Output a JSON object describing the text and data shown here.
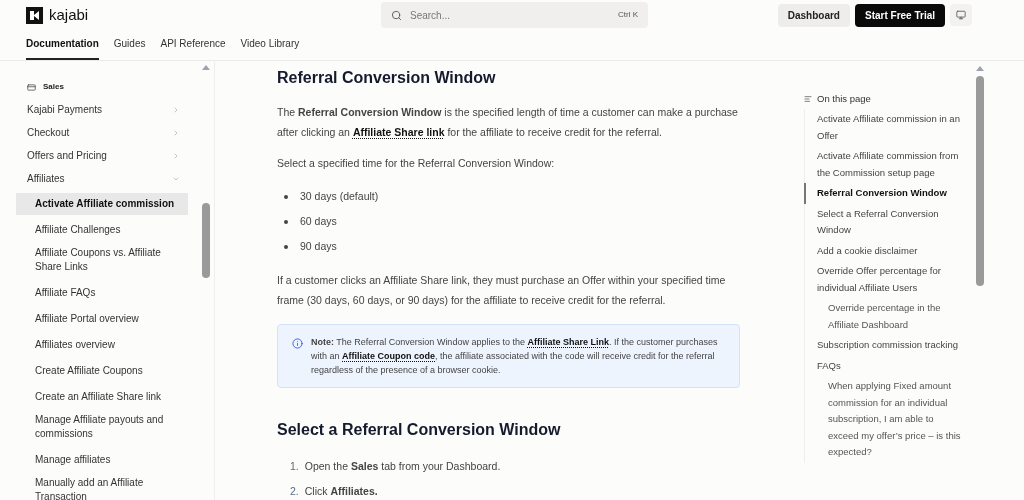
{
  "header": {
    "logo_text": "kajabi",
    "search": {
      "placeholder": "Search...",
      "shortcut": "Ctrl K"
    },
    "buttons": [
      {
        "label": "Dashboard",
        "kind": "secondary"
      },
      {
        "label": "Start Free Trial",
        "kind": "primary"
      }
    ]
  },
  "tabs": [
    {
      "label": "Documentation",
      "selected": true
    },
    {
      "label": "Guides",
      "selected": false
    },
    {
      "label": "API Reference",
      "selected": false
    },
    {
      "label": "Video Library",
      "selected": false
    }
  ],
  "sidebar": {
    "section": "Sales",
    "items": [
      {
        "label": "Kajabi Payments",
        "expanded": false
      },
      {
        "label": "Checkout",
        "expanded": false
      },
      {
        "label": "Offers and Pricing",
        "expanded": false
      },
      {
        "label": "Affiliates",
        "expanded": true,
        "children": [
          {
            "label": "Activate Affiliate commission",
            "selected": true
          },
          {
            "label": "Affiliate Challenges",
            "selected": false
          },
          {
            "label": "Affiliate Coupons vs. Affiliate Share Links",
            "selected": false
          },
          {
            "label": "Affiliate FAQs",
            "selected": false
          },
          {
            "label": "Affiliate Portal overview",
            "selected": false
          },
          {
            "label": "Affiliates overview",
            "selected": false
          },
          {
            "label": "Create Affiliate Coupons",
            "selected": false
          },
          {
            "label": "Create an Affiliate Share link",
            "selected": false
          },
          {
            "label": "Manage Affiliate payouts and commissions",
            "selected": false
          },
          {
            "label": "Manage affiliates",
            "selected": false
          },
          {
            "label": "Manually add an Affiliate Transaction",
            "selected": false
          }
        ]
      }
    ]
  },
  "content": [
    {
      "kind": "h2",
      "text": "Referral Conversion Window"
    },
    {
      "kind": "p",
      "parts": [
        {
          "kind": "text",
          "text": "The **Referral Conversion Window** is the specified length of time a customer can make a purchase after clicking an "
        },
        {
          "kind": "link",
          "text": "Affiliate Share link"
        },
        {
          "kind": "text",
          "text": " for the affiliate to receive credit for the referral."
        }
      ]
    },
    {
      "kind": "p",
      "parts": [
        {
          "kind": "text",
          "text": "Select a specified time for the Referral Conversion Window:"
        }
      ]
    },
    {
      "kind": "ul",
      "items": [
        "30 days (default)",
        "60 days",
        "90 days"
      ]
    },
    {
      "kind": "p",
      "parts": [
        {
          "kind": "text",
          "text": "If a customer clicks an Affiliate Share link, they must purchase an Offer within your specified time frame (30 days, 60 days, or 90 days) for the affiliate to receive credit for the referral."
        }
      ]
    },
    {
      "kind": "note",
      "parts": [
        {
          "kind": "text",
          "text": "**Note:** The Referral Conversion Window applies to the "
        },
        {
          "kind": "link",
          "text": "Affiliate Share Link"
        },
        {
          "kind": "text",
          "text": ". If the customer purchases with an "
        },
        {
          "kind": "link",
          "text": "Affiliate Coupon code"
        },
        {
          "kind": "text",
          "text": ", the affiliate associated with the code will receive credit for the referral regardless of the presence of a browser cookie."
        }
      ]
    },
    {
      "kind": "h2",
      "text": "Select a Referral Conversion Window"
    },
    {
      "kind": "ol",
      "items": [
        {
          "number": "1.",
          "text": "Open the **Sales** tab from your Dashboard."
        },
        {
          "number": "2.",
          "text": "Click **Affiliates.**"
        }
      ]
    }
  ],
  "toc": {
    "title": "On this page",
    "items": [
      {
        "label": "Activate Affiliate commission in an Offer",
        "selected": false
      },
      {
        "label": "Activate Affiliate commission from the Commission setup page",
        "selected": false
      },
      {
        "label": "Referral Conversion Window",
        "selected": true
      },
      {
        "label": "Select a Referral Conversion Window",
        "selected": false
      },
      {
        "label": "Add a cookie disclaimer",
        "selected": false
      },
      {
        "label": "Override Offer percentage for individual Affiliate Users",
        "selected": false,
        "children": [
          {
            "label": "Override percentage in the Affiliate Dashboard",
            "selected": false
          }
        ]
      },
      {
        "label": "Subscription commission tracking",
        "selected": false
      },
      {
        "label": "FAQs",
        "selected": false,
        "children": [
          {
            "label": "When applying Fixed amount commission for an individual subscription, I am able to exceed my offer’s price – is this expected?",
            "selected": false
          }
        ]
      }
    ]
  }
}
